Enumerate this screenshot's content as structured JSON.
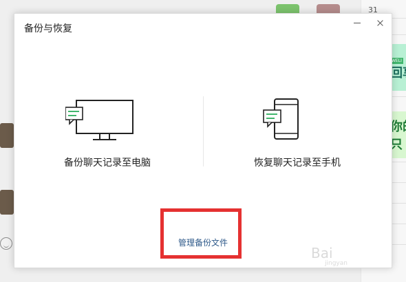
{
  "background": {
    "calendar_day": "31",
    "watermark_main": "Bai",
    "watermark_sub": "jingyan",
    "promo_1_mini": "WELI",
    "promo_1_text": "回享",
    "promo_2_text_a": "你的",
    "promo_2_text_b": "只"
  },
  "dialog": {
    "title": "备份与恢复",
    "minimize_icon": "minimize-icon",
    "close_icon": "close-icon",
    "backup_option": {
      "label": "备份聊天记录至电脑",
      "icon": "monitor-chat-icon"
    },
    "restore_option": {
      "label": "恢复聊天记录至手机",
      "icon": "phone-chat-icon"
    },
    "manage_link": "管理备份文件",
    "colors": {
      "accent_green": "#41b66d",
      "link_blue": "#2f5a8a",
      "highlight_red": "#e53131"
    }
  }
}
